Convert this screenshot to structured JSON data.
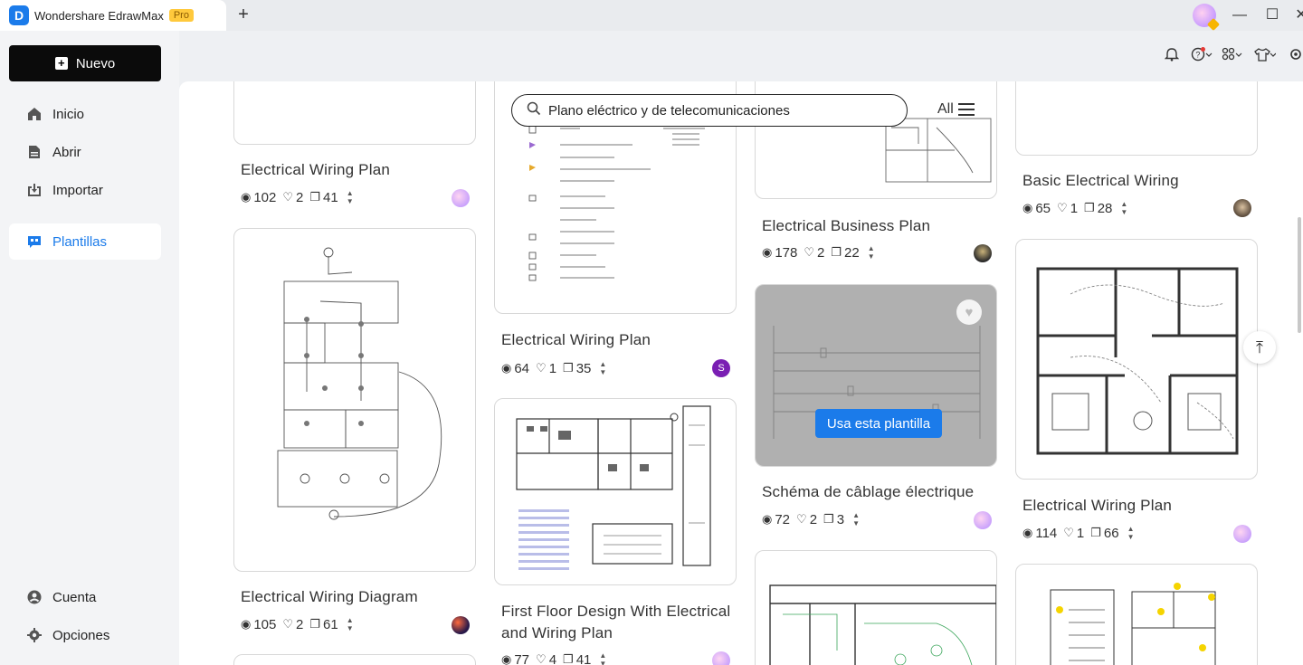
{
  "app": {
    "logo_letter": "D",
    "title": "Wondershare EdrawMax",
    "badge": "Pro",
    "new_tab": "+"
  },
  "window": {
    "minimize": "—",
    "maximize": "☐",
    "close": "✕"
  },
  "sidebar": {
    "new_label": "Nuevo",
    "items": [
      {
        "label": "Inicio",
        "icon": "home-icon"
      },
      {
        "label": "Abrir",
        "icon": "file-icon"
      },
      {
        "label": "Importar",
        "icon": "import-icon"
      },
      {
        "label": "Plantillas",
        "icon": "templates-icon"
      }
    ],
    "bottom": [
      {
        "label": "Cuenta",
        "icon": "account-icon"
      },
      {
        "label": "Opciones",
        "icon": "settings-icon"
      }
    ]
  },
  "search": {
    "value": "Plano eléctrico y de telecomunicaciones",
    "filter_label": "All"
  },
  "templates": [
    {
      "title": "Electrical Wiring Plan",
      "views": "102",
      "likes": "2",
      "copies": "41"
    },
    {
      "title": "Electrical Wiring Diagram",
      "views": "105",
      "likes": "2",
      "copies": "61"
    },
    {
      "title": "Electrical Wiring Plan",
      "views": "64",
      "likes": "1",
      "copies": "35",
      "author_initial": "S"
    },
    {
      "title_line1": "First Floor Design With Electrical",
      "title_line2": "and Wiring Plan",
      "views": "77",
      "likes": "4",
      "copies": "41"
    },
    {
      "title": "Electrical Business Plan",
      "views": "178",
      "likes": "2",
      "copies": "22"
    },
    {
      "title": "Schéma de câblage électrique",
      "views": "72",
      "likes": "2",
      "copies": "3",
      "use_button": "Usa esta plantilla"
    },
    {
      "title": "Basic Electrical Wiring",
      "views": "65",
      "likes": "1",
      "copies": "28"
    },
    {
      "title": "Electrical Wiring Plan",
      "views": "114",
      "likes": "1",
      "copies": "66"
    }
  ],
  "colors": {
    "accent": "#1b7bea",
    "badge": "#ffc93c"
  }
}
